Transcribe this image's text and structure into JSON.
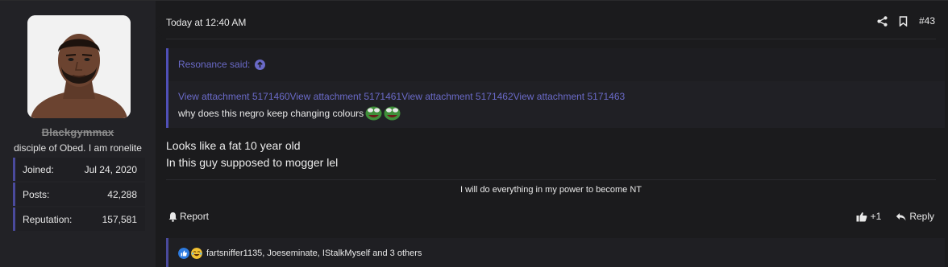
{
  "user": {
    "username": "Blackgymmax",
    "title": "disciple of Obed. I am ronelite",
    "avatar_icon": "user-avatar-photo",
    "stats": [
      {
        "label": "Joined:",
        "value": "Jul 24, 2020"
      },
      {
        "label": "Posts:",
        "value": "42,288"
      },
      {
        "label": "Reputation:",
        "value": "157,581"
      }
    ]
  },
  "post": {
    "date": "Today at 12:40 AM",
    "number": "#43",
    "quote": {
      "author_line": "Resonance said:",
      "attachments": [
        "View attachment 5171460",
        "View attachment 5171461",
        "View attachment 5171462",
        "View attachment 5171463"
      ],
      "text": "why does this negro keep changing colours"
    },
    "message": [
      "Looks like a fat 10 year old",
      "In this guy supposed to mogger lel"
    ],
    "signature": "I will do everything in my power to become NT",
    "report_label": "Report",
    "like_count": "+1",
    "reply_label": "Reply",
    "reactions_text": "fartsniffer1135, Joeseminate, IStalkMyself and 3 others"
  },
  "colors": {
    "accent": "#6a6ac8",
    "sidebar_bg": "#222226",
    "page_bg": "#1b1b1d"
  }
}
